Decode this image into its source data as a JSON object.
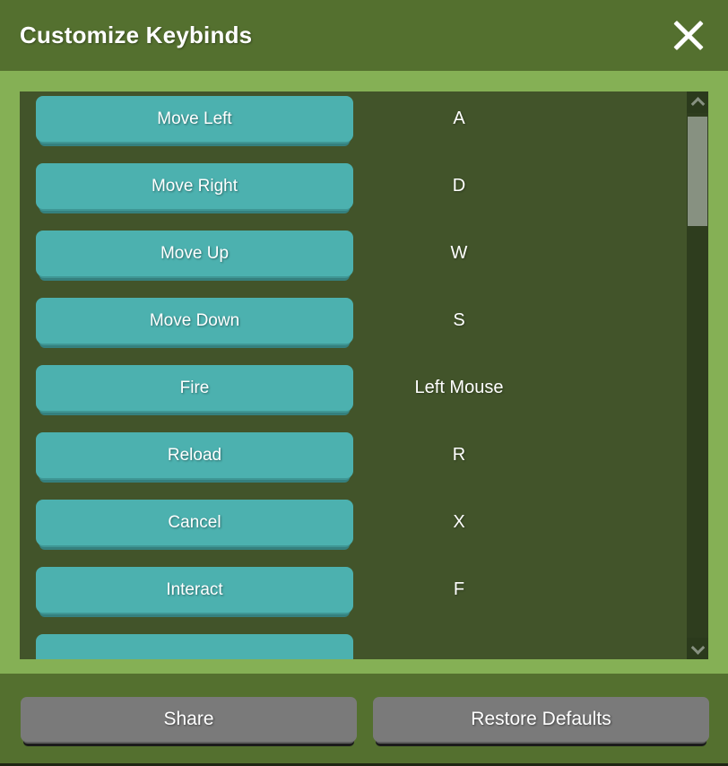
{
  "header": {
    "title": "Customize Keybinds",
    "close_icon": "close-icon"
  },
  "keybinds": {
    "rows": [
      {
        "action": "Move Left",
        "key": "A"
      },
      {
        "action": "Move Right",
        "key": "D"
      },
      {
        "action": "Move Up",
        "key": "W"
      },
      {
        "action": "Move Down",
        "key": "S"
      },
      {
        "action": "Fire",
        "key": "Left Mouse"
      },
      {
        "action": "Reload",
        "key": "R"
      },
      {
        "action": "Cancel",
        "key": "X"
      },
      {
        "action": "Interact",
        "key": "F"
      },
      {
        "action": "",
        "key": ""
      }
    ]
  },
  "scrollbar": {
    "up_icon": "chevron-up-icon",
    "down_icon": "chevron-down-icon"
  },
  "footer": {
    "share_label": "Share",
    "restore_label": "Restore Defaults"
  },
  "colors": {
    "header_bg": "#54702F",
    "light_green": "#85B055",
    "panel_bg": "#42542A",
    "action_teal": "#4CB1AF",
    "action_teal_edge": "#35807E",
    "footer_gray": "#7A7A7A",
    "scroll_track": "#2E3D1E",
    "scroll_thumb": "#879181",
    "text_white": "#FFFFFF"
  }
}
